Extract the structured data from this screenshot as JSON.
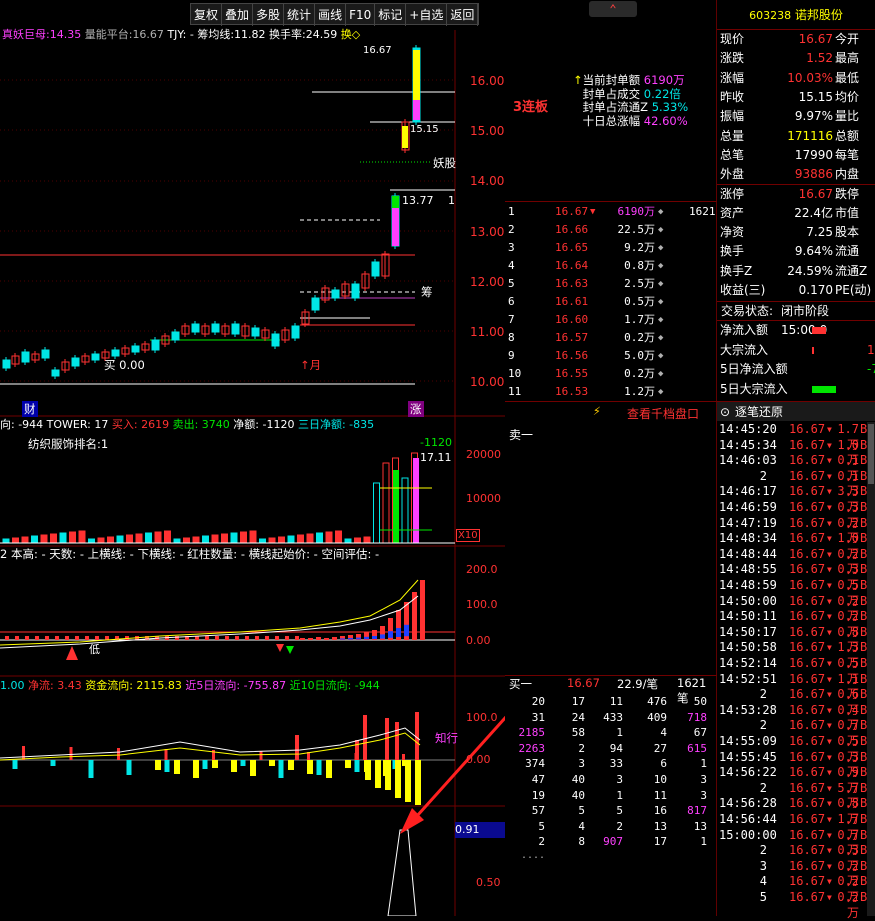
{
  "toolbar": {
    "buttons": [
      "复权",
      "叠加",
      "多股",
      "统计",
      "画线",
      "F10",
      "标记",
      "+自选",
      "返回"
    ]
  },
  "main_header": {
    "t1": "真妖巨母:",
    "t1v": "14.35",
    "t2": "量能平台:",
    "t2v": "16.67",
    "t3": "TJY:",
    "t4": "- 筹均线:",
    "t4v": "11.82",
    "t5": "换手率:",
    "t5v": "24.59",
    "t6": "换◇"
  },
  "price_axis": [
    "16.00",
    "15.00",
    "14.00",
    "13.00",
    "12.00",
    "11.00",
    "10.00"
  ],
  "price_labels": {
    "high": "16.67",
    "hi_line": "15.15",
    "yao": "妖股",
    "mid": "13.77",
    "mid_r": "1",
    "chou": "筹",
    "buy": "买 0.00",
    "month": "月",
    "cai": "财",
    "zhang": "涨"
  },
  "limit_info": {
    "lianban": "3连板",
    "lines": [
      {
        "label": "当前封单额",
        "value": "6190万"
      },
      {
        "label": "封单占成交",
        "value": "0.22倍"
      },
      {
        "label": "封单占流通Z",
        "value": "5.33%"
      },
      {
        "label": "十日总涨幅",
        "value": "42.60%"
      }
    ]
  },
  "orderbook": [
    {
      "n": "1",
      "p": "16.67",
      "v": "6190万",
      "t": "1621"
    },
    {
      "n": "2",
      "p": "16.66",
      "v": "22.5万",
      "t": ""
    },
    {
      "n": "3",
      "p": "16.65",
      "v": "9.2万",
      "t": ""
    },
    {
      "n": "4",
      "p": "16.64",
      "v": "0.8万",
      "t": ""
    },
    {
      "n": "5",
      "p": "16.63",
      "v": "2.5万",
      "t": ""
    },
    {
      "n": "6",
      "p": "16.61",
      "v": "0.5万",
      "t": ""
    },
    {
      "n": "7",
      "p": "16.60",
      "v": "1.7万",
      "t": ""
    },
    {
      "n": "8",
      "p": "16.57",
      "v": "0.2万",
      "t": ""
    },
    {
      "n": "9",
      "p": "16.56",
      "v": "5.0万",
      "t": ""
    },
    {
      "n": "10",
      "p": "16.55",
      "v": "0.2万",
      "t": ""
    },
    {
      "n": "11",
      "p": "16.53",
      "v": "1.2万",
      "t": ""
    }
  ],
  "qiandang": "查看千档盘口",
  "sell_one": "卖一",
  "buy_summary": {
    "label": "买一",
    "price": "16.67",
    "per": "22.9/笔",
    "count": "1621笔"
  },
  "queue": [
    [
      "20",
      "17",
      "11",
      "476",
      "50"
    ],
    [
      "31",
      "24",
      "433",
      "409",
      "718"
    ],
    [
      "2185",
      "58",
      "1",
      "4",
      "67"
    ],
    [
      "2263",
      "2",
      "94",
      "27",
      "615"
    ],
    [
      "374",
      "3",
      "33",
      "6",
      "1"
    ],
    [
      "47",
      "40",
      "3",
      "10",
      "3"
    ],
    [
      "19",
      "40",
      "1",
      "11",
      "3"
    ],
    [
      "57",
      "5",
      "5",
      "16",
      "817"
    ],
    [
      "5",
      "4",
      "2",
      "13",
      "13"
    ],
    [
      "2",
      "8",
      "907",
      "17",
      "1"
    ]
  ],
  "queue_more": "....",
  "vol_header": {
    "a": "向: -944",
    "b": "TOWER: 17",
    "c": "买入: 2619",
    "d": "卖出: 3740",
    "e": "净额: -1120",
    "f": "三日净额: -835"
  },
  "vol_axis": [
    "20000",
    "10000"
  ],
  "vol_labels": {
    "rank": "纺织服饰排名:1",
    "net": "-1120",
    "price": "17.11",
    "x10": "X10"
  },
  "ind_header": {
    "a": "2 本高: - 天数: - 上横线: - 下横线: - 红柱数量: - 横线起始价: - 空间评估: -"
  },
  "ind_axis": [
    "200.0",
    "100.0",
    "0.00"
  ],
  "ind_labels": {
    "tag": "低"
  },
  "flow_header": {
    "a": "1.00",
    "b": "净流: 3.43",
    "c": "资金流向: 2115.83",
    "d": "近5日流向: -755.87",
    "e": "近10日流向: -944"
  },
  "flow_axis": [
    "100.0",
    "0.00"
  ],
  "flow_labels": {
    "know": "知行"
  },
  "bottom_axis": {
    "v1": "0.91",
    "v2": "0.50"
  },
  "stock": {
    "code": "603238",
    "name": "诺邦股份"
  },
  "quote": [
    {
      "l": "现价",
      "v": "16.67",
      "r": "今开",
      "vc": "red"
    },
    {
      "l": "涨跌",
      "v": "1.52",
      "r": "最高",
      "vc": "red"
    },
    {
      "l": "涨幅",
      "v": "10.03%",
      "r": "最低",
      "vc": "red"
    },
    {
      "l": "昨收",
      "v": "15.15",
      "r": "均价",
      "vc": "wht"
    },
    {
      "l": "振幅",
      "v": "9.97%",
      "r": "量比",
      "vc": "wht"
    },
    {
      "l": "总量",
      "v": "171116",
      "r": "总额",
      "vc": "yel"
    },
    {
      "l": "总笔",
      "v": "17990",
      "r": "每笔",
      "vc": "wht"
    },
    {
      "l": "外盘",
      "v": "93886",
      "r": "内盘",
      "vc": "red"
    },
    {
      "l": "涨停",
      "v": "16.67",
      "r": "跌停",
      "vc": "red"
    },
    {
      "l": "资产",
      "v": "22.4亿",
      "r": "市值",
      "vc": "wht"
    },
    {
      "l": "净资",
      "v": "7.25",
      "r": "股本",
      "vc": "wht"
    },
    {
      "l": "换手",
      "v": "9.64%",
      "r": "流通",
      "vc": "wht"
    },
    {
      "l": "换手Z",
      "v": "24.59%",
      "r": "流通Z",
      "vc": "wht"
    },
    {
      "l": "收益(三)",
      "v": "0.170",
      "r": "PE(动)",
      "vc": "wht"
    }
  ],
  "trade_status": {
    "label": "交易状态:",
    "value": "闭市阶段 15:00:0"
  },
  "flows": [
    {
      "l": "净流入额",
      "r": ""
    },
    {
      "l": "大宗流入",
      "r": "1"
    },
    {
      "l": "5日净流入额",
      "r": "-7"
    },
    {
      "l": "5日大宗流入",
      "r": ""
    }
  ],
  "ticks_header": "逐笔还原",
  "ticks": [
    {
      "t": "14:45:20",
      "p": "16.67",
      "v": "1.7万",
      "s": "B"
    },
    {
      "t": "14:45:34",
      "p": "16.67",
      "v": "1.0万",
      "s": "B"
    },
    {
      "t": "14:46:03",
      "p": "16.67",
      "v": "0.1万",
      "s": "B"
    },
    {
      "t": "2",
      "p": "16.67",
      "v": "0.1万",
      "s": "B"
    },
    {
      "t": "14:46:17",
      "p": "16.67",
      "v": "3.3万",
      "s": "B"
    },
    {
      "t": "14:46:59",
      "p": "16.67",
      "v": "0.3万",
      "s": "B"
    },
    {
      "t": "14:47:19",
      "p": "16.67",
      "v": "0.2万",
      "s": "B"
    },
    {
      "t": "14:48:34",
      "p": "16.67",
      "v": "1.0万",
      "s": "B"
    },
    {
      "t": "14:48:44",
      "p": "16.67",
      "v": "0.2万",
      "s": "B"
    },
    {
      "t": "14:48:55",
      "p": "16.67",
      "v": "0.3万",
      "s": "B"
    },
    {
      "t": "14:48:59",
      "p": "16.67",
      "v": "0.5万",
      "s": "B"
    },
    {
      "t": "14:50:00",
      "p": "16.67",
      "v": "0.2万",
      "s": "B"
    },
    {
      "t": "14:50:11",
      "p": "16.67",
      "v": "0.2万",
      "s": "B"
    },
    {
      "t": "14:50:17",
      "p": "16.67",
      "v": "0.8万",
      "s": "B"
    },
    {
      "t": "14:50:58",
      "p": "16.67",
      "v": "1.3万",
      "s": "B"
    },
    {
      "t": "14:52:14",
      "p": "16.67",
      "v": "0.5万",
      "s": "B"
    },
    {
      "t": "14:52:51",
      "p": "16.67",
      "v": "1.1万",
      "s": "B"
    },
    {
      "t": "2",
      "p": "16.67",
      "v": "0.6万",
      "s": "B"
    },
    {
      "t": "14:53:28",
      "p": "16.67",
      "v": "0.4万",
      "s": "B"
    },
    {
      "t": "2",
      "p": "16.67",
      "v": "0.7万",
      "s": "B"
    },
    {
      "t": "14:55:09",
      "p": "16.67",
      "v": "0.5万",
      "s": "B"
    },
    {
      "t": "14:55:45",
      "p": "16.67",
      "v": "0.3万",
      "s": "B"
    },
    {
      "t": "14:56:22",
      "p": "16.67",
      "v": "0.9万",
      "s": "B"
    },
    {
      "t": "2",
      "p": "16.67",
      "v": "5.7万",
      "s": "B"
    },
    {
      "t": "14:56:28",
      "p": "16.67",
      "v": "0.8万",
      "s": "B"
    },
    {
      "t": "14:56:44",
      "p": "16.67",
      "v": "1.7万",
      "s": "B"
    },
    {
      "t": "15:00:00",
      "p": "16.67",
      "v": "0.7万",
      "s": "B"
    },
    {
      "t": "2",
      "p": "16.67",
      "v": "0.3万",
      "s": "B"
    },
    {
      "t": "3",
      "p": "16.67",
      "v": "0.2万",
      "s": "B"
    },
    {
      "t": "4",
      "p": "16.67",
      "v": "0.2万",
      "s": "B"
    },
    {
      "t": "5",
      "p": "16.67",
      "v": "0.2万",
      "s": "B"
    }
  ]
}
